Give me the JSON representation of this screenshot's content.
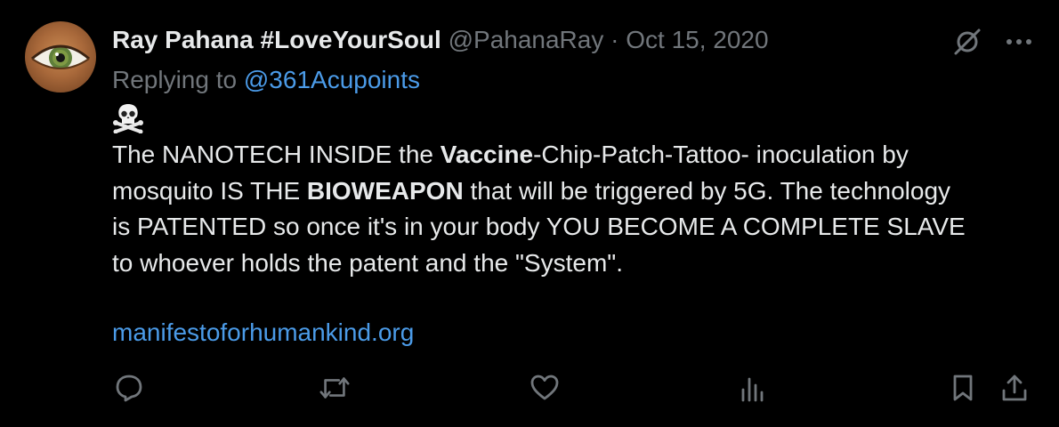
{
  "tweet": {
    "author_name": "Ray Pahana #LoveYourSoul",
    "handle": "@PahanaRay",
    "separator": "·",
    "date": "Oct 15, 2020",
    "replying_prefix": "Replying to",
    "replying_to": "@361Acupoints",
    "emoji": "☠️",
    "text": {
      "l1_a": "The NANOTECH INSIDE the ",
      "l1_b": "Vaccine",
      "l1_c": "-Chip-Patch-Tattoo- inoculation by",
      "l2_a": "mosquito IS THE ",
      "l2_b": "BIOWEAPON",
      "l2_c": " that will be triggered by 5G. The technology",
      "l3": "is PATENTED so once it's in your body YOU BECOME A COMPLETE SLAVE",
      "l4": "to whoever holds the patent and the \"System\"."
    },
    "link_url": "manifestoforhumankind.org"
  },
  "icons": {
    "top": [
      "grok-icon",
      "more-icon"
    ],
    "actions": [
      "reply-icon",
      "retweet-icon",
      "like-icon",
      "views-icon",
      "bookmark-icon",
      "share-icon"
    ]
  }
}
